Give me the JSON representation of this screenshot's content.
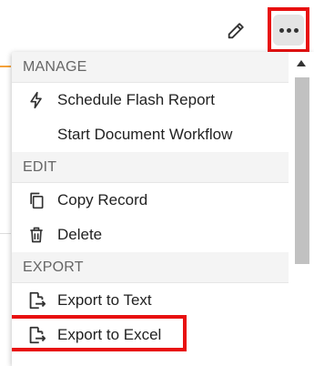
{
  "toolbar": {
    "edit_icon": "pencil-icon",
    "more_icon": "more-horizontal-icon"
  },
  "menu": {
    "sections": [
      {
        "header": "MANAGE",
        "items": [
          {
            "label": "Schedule Flash Report",
            "icon": "lightning-icon"
          },
          {
            "label": "Start Document Workflow",
            "icon": ""
          }
        ]
      },
      {
        "header": "EDIT",
        "items": [
          {
            "label": "Copy Record",
            "icon": "copy-icon"
          },
          {
            "label": "Delete",
            "icon": "trash-icon"
          }
        ]
      },
      {
        "header": "EXPORT",
        "items": [
          {
            "label": "Export to Text",
            "icon": "file-export-icon"
          },
          {
            "label": "Export to Excel",
            "icon": "file-export-icon"
          }
        ]
      }
    ]
  },
  "colors": {
    "highlight": "#e81010",
    "accent": "#f5a23a"
  }
}
